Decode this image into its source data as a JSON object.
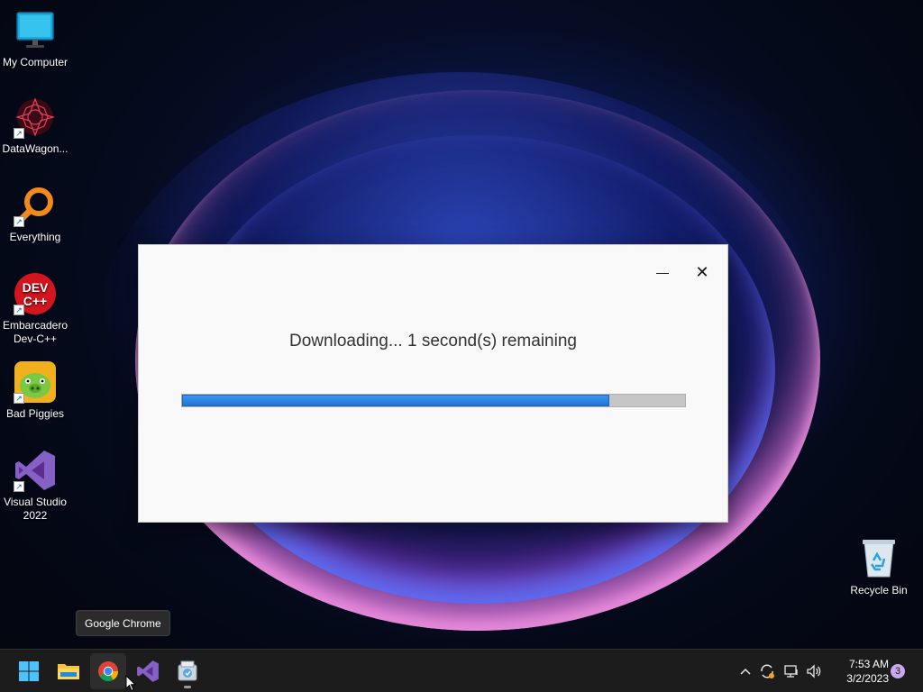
{
  "desktop": {
    "icons": [
      {
        "label": "My Computer",
        "icon": "monitor-icon"
      },
      {
        "label": "DataWagon...",
        "icon": "datawagon-icon"
      },
      {
        "label": "Everything",
        "icon": "everything-search-icon"
      },
      {
        "label": "Embarcadero Dev-C++",
        "icon": "devcpp-icon",
        "badge": "DEV C++"
      },
      {
        "label": "Bad Piggies",
        "icon": "bad-piggies-icon"
      },
      {
        "label": "Visual Studio 2022",
        "icon": "visual-studio-icon"
      }
    ],
    "recycle_bin": {
      "label": "Recycle Bin",
      "icon": "recycle-bin-icon"
    }
  },
  "dialog": {
    "message": "Downloading... 1 second(s) remaining",
    "progress": 0.85,
    "minimize_glyph": "—",
    "close_glyph": "✕"
  },
  "tooltip": {
    "text": "Google Chrome"
  },
  "taskbar": {
    "pinned": [
      {
        "name": "Start",
        "icon": "windows-start-icon"
      },
      {
        "name": "File Explorer",
        "icon": "folder-icon"
      },
      {
        "name": "Google Chrome",
        "icon": "chrome-icon",
        "active": true
      },
      {
        "name": "Visual Studio",
        "icon": "visual-studio-icon"
      },
      {
        "name": "Installer",
        "icon": "installer-icon",
        "running": true
      }
    ],
    "tray": {
      "chevron": "^",
      "time": "7:53 AM",
      "date": "3/2/2023",
      "notifications": "3"
    }
  },
  "colors": {
    "accent": "#1f73d6",
    "taskbar": "#1c1c1c",
    "dialog_bg": "#f9f9f9"
  }
}
